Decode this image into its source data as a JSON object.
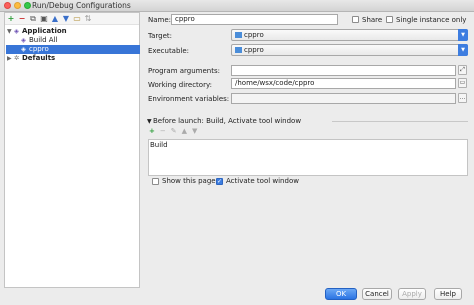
{
  "window": {
    "title": "Run/Debug Configurations"
  },
  "tree_toolbar": {
    "icons": [
      "add-icon",
      "remove-icon",
      "copy-icon",
      "save-icon",
      "move-up-icon",
      "move-down-icon",
      "folder-icon",
      "sort-icon"
    ],
    "glyphs": [
      "+",
      "−",
      "⧉",
      "▣",
      "▲",
      "▼",
      "▭",
      "⇅"
    ]
  },
  "tree": {
    "application_label": "Application",
    "build_all_label": "Build All",
    "cppro_label": "cppro",
    "defaults_label": "Defaults"
  },
  "form": {
    "name_label": "Name:",
    "name_value": "cppro",
    "share_label": "Share",
    "single_instance_label": "Single instance only",
    "target_label": "Target:",
    "target_value": "cppro",
    "executable_label": "Executable:",
    "executable_value": "cppro",
    "program_args_label": "Program arguments:",
    "program_args_value": "",
    "working_dir_label": "Working directory:",
    "working_dir_value": "/home/wsx/code/cppro",
    "env_vars_label": "Environment variables:",
    "env_vars_value": "",
    "ellipsis": "...",
    "browse_folder": "▭"
  },
  "before_launch": {
    "header": "Before launch: Build, Activate tool window",
    "toolbar_glyphs": [
      "+",
      "−",
      "✎",
      "▲",
      "▼"
    ],
    "items": [
      "Build"
    ],
    "show_page_label": "Show this page",
    "activate_tool_window_label": "Activate tool window",
    "show_page_checked": false,
    "activate_tool_window_checked": true
  },
  "buttons": {
    "ok": "OK",
    "cancel": "Cancel",
    "apply": "Apply",
    "help": "Help"
  }
}
